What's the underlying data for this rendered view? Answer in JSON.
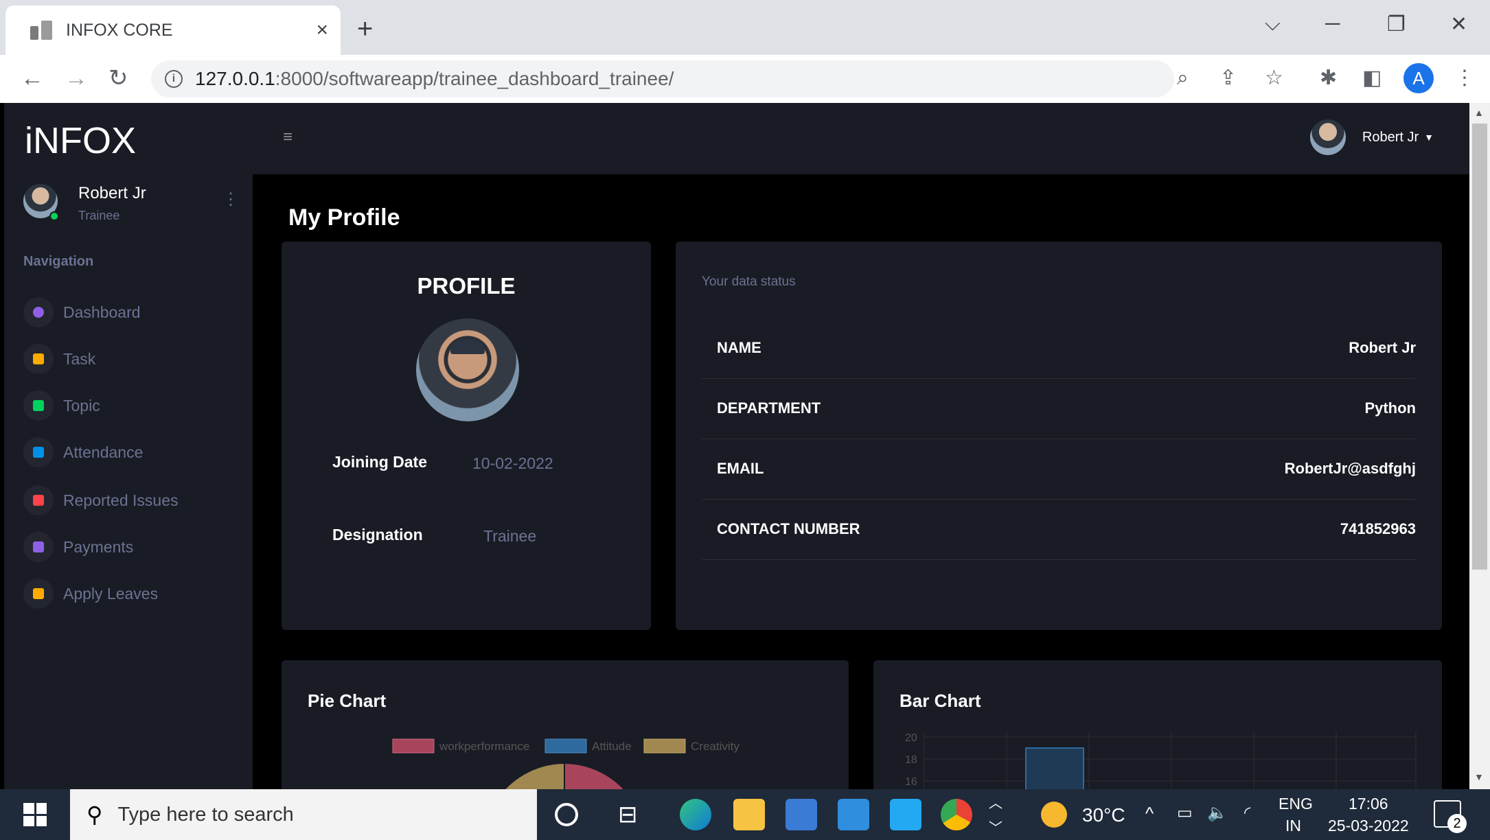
{
  "browser": {
    "tab_title": "INFOX CORE",
    "tab_close": "×",
    "new_tab": "+",
    "url_host": "127.0.0.1",
    "url_rest": ":8000/softwareapp/trainee_dashboard_trainee/",
    "profile_initial": "A"
  },
  "sidebar": {
    "brand": "iNFOX",
    "user_name": "Robert Jr",
    "user_role": "Trainee",
    "nav_label": "Navigation",
    "items": [
      {
        "label": "Dashboard",
        "color": "#8f5fe8"
      },
      {
        "label": "Task",
        "color": "#ffab00"
      },
      {
        "label": "Topic",
        "color": "#00d25b"
      },
      {
        "label": "Attendance",
        "color": "#0090e7"
      },
      {
        "label": "Reported Issues",
        "color": "#fc424a"
      },
      {
        "label": "Payments",
        "color": "#8f5fe8"
      },
      {
        "label": "Apply Leaves",
        "color": "#ffab00"
      }
    ]
  },
  "topbar": {
    "user_name": "Robert Jr"
  },
  "main": {
    "page_title": "My Profile",
    "profile": {
      "heading": "PROFILE",
      "joining_label": "Joining Date",
      "joining_value": "10-02-2022",
      "designation_label": "Designation",
      "designation_value": "Trainee"
    },
    "data_status": {
      "heading": "Your data status",
      "rows": [
        {
          "key": "NAME",
          "value": "Robert Jr"
        },
        {
          "key": "DEPARTMENT",
          "value": "Python"
        },
        {
          "key": "EMAIL",
          "value": "RobertJr@asdfghj"
        },
        {
          "key": "CONTACT NUMBER",
          "value": "741852963"
        }
      ]
    },
    "pie_chart": {
      "title": "Pie Chart",
      "legend": [
        {
          "label": "workperformance",
          "color": "#a8455d"
        },
        {
          "label": "Attitude",
          "color": "#2e6a9e"
        },
        {
          "label": "Creativity",
          "color": "#a08850"
        }
      ]
    },
    "bar_chart": {
      "title": "Bar Chart",
      "y_ticks": [
        "20",
        "18",
        "16"
      ],
      "bar_color": "#2e6a9e"
    }
  },
  "taskbar": {
    "search_placeholder": "Type here to search",
    "temperature": "30°C",
    "lang": "ENG",
    "region": "IN",
    "time": "17:06",
    "date": "25-03-2022",
    "notifications": "2"
  }
}
